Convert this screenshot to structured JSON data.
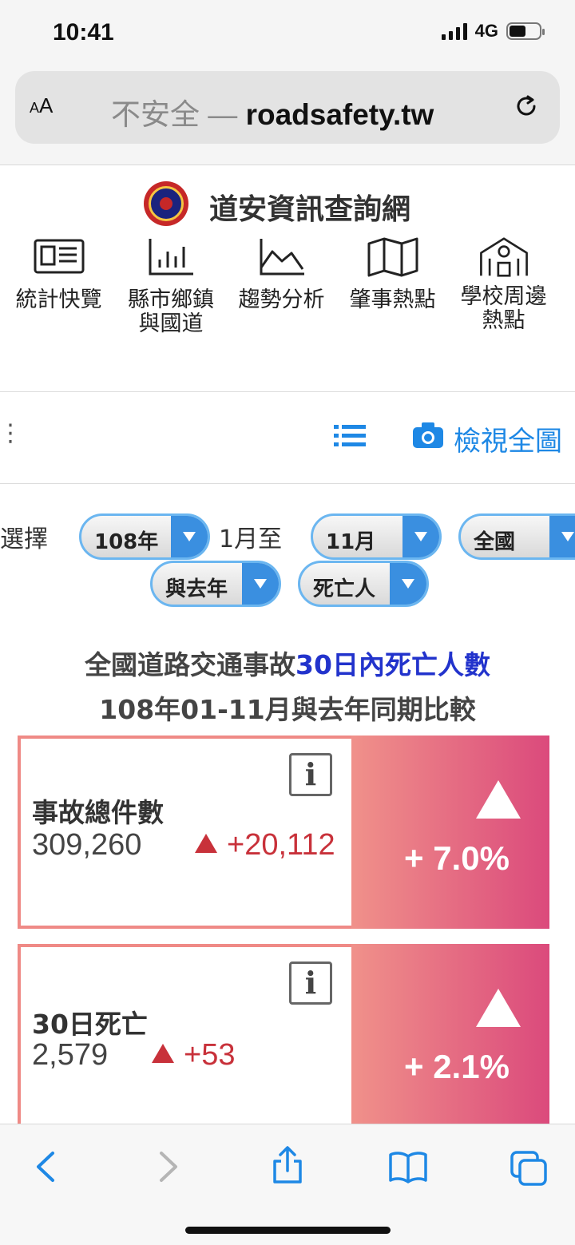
{
  "status": {
    "time": "10:41",
    "network": "4G"
  },
  "browser": {
    "aa_small": "A",
    "aa_big": "A",
    "url_insecure": "不安全 — ",
    "url_host": "roadsafety.tw"
  },
  "site": {
    "title": "道安資訊查詢網",
    "nav": [
      {
        "label": "統計快覽",
        "icon": "newspaper-icon"
      },
      {
        "label": "縣市鄉鎮與國道",
        "icon": "bar-chart-icon"
      },
      {
        "label": "趨勢分析",
        "icon": "area-chart-icon"
      },
      {
        "label": "肇事熱點",
        "icon": "map-icon"
      },
      {
        "label": "學校周邊熱點",
        "icon": "school-icon"
      }
    ]
  },
  "toolbar": {
    "edge_glyph": "⋮",
    "view_all_label": "檢視全圖"
  },
  "filters": {
    "select_label": "選擇",
    "year": "108年",
    "from_label": "1月至",
    "month": "11月",
    "region": "全國",
    "compare": "與去年",
    "metric": "死亡人"
  },
  "headline": {
    "prefix": "全國道路交通事故",
    "highlight": "30日內死亡人數",
    "subline": "108年01-11月與去年同期比較"
  },
  "cards": [
    {
      "label": "事故總件數",
      "value": "309,260",
      "delta": "+20,112",
      "percent": "+ 7.0%",
      "info": "i"
    },
    {
      "label": "30日死亡",
      "value": "2,579",
      "delta": "+53",
      "percent": "+ 2.1%",
      "info": "i"
    }
  ],
  "colors": {
    "accent_blue": "#1e88e5",
    "active_tab": "#c62828",
    "inactive_tab": "#f2a3a0",
    "delta_red": "#c8313a",
    "card_gradient_start": "#f0918a",
    "card_gradient_end": "#db4a7c"
  }
}
